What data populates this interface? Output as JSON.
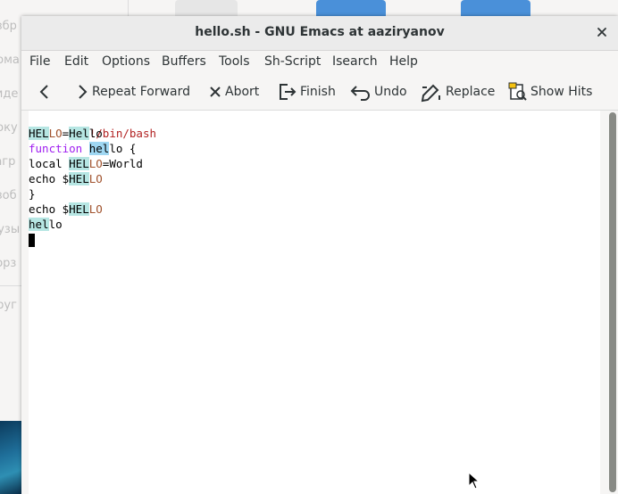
{
  "background": {
    "sidebar_items": [
      "Избр",
      "Дома",
      "Виде",
      "Доку",
      "Загр",
      "Изоб",
      "Музы",
      "Корз",
      "Друг"
    ]
  },
  "window": {
    "title": "hello.sh - GNU Emacs at aaziryanov"
  },
  "menu": [
    "File",
    "Edit",
    "Options",
    "Buffers",
    "Tools",
    "Sh-Script",
    "Isearch",
    "Help"
  ],
  "toolbar": {
    "repeat_forward": "Repeat Forward",
    "abort": "Abort",
    "finish": "Finish",
    "undo": "Undo",
    "replace": "Replace",
    "show_hits": "Show Hits"
  },
  "editor": {
    "lines": [
      "#!/bin/bash",
      "HELLO=Hello",
      "function hello {",
      "local HELLO=World",
      "echo $HELLO",
      "}",
      "echo $HELLO",
      "hello"
    ]
  },
  "colors": {
    "keyword": "#a020f0",
    "comment": "#b22222",
    "variable": "#a0522d",
    "search_highlight": "#b6e6e3"
  }
}
